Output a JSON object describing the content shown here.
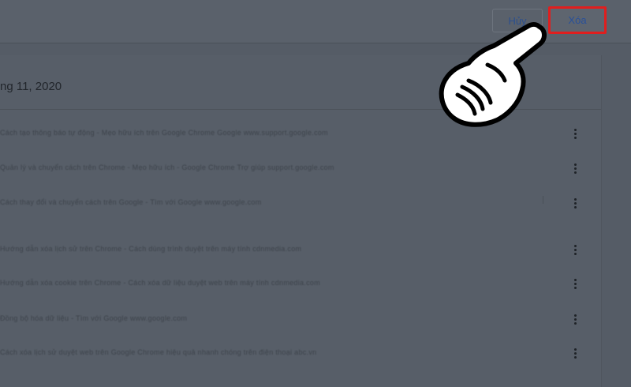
{
  "toolbar": {
    "cancel_label": "Hủy",
    "delete_label": "Xóa"
  },
  "section": {
    "date": "ng 11, 2020"
  },
  "rows": [
    {
      "text": "Cách tạo thông báo tự động - Mẹo hữu ích trên Google Chrome Google   www.support.google.com"
    },
    {
      "text": "Quản lý và chuyển cách trên Chrome - Mẹo hữu ích - Google Chrome Trợ giúp   support.google.com"
    },
    {
      "text": "Cách thay đổi và chuyển cách trên Google - Tìm với Google   www.google.com"
    },
    {
      "text": "Hướng dẫn xóa lịch sử trên Chrome - Cách dùng trình duyệt trên máy tính   cdnmedia.com"
    },
    {
      "text": "Hướng dẫn xóa cookie trên Chrome - Cách xóa dữ liệu duyệt web trên máy tính   cdnmedia.com"
    },
    {
      "text": "Đồng bộ hóa dữ liệu - Tìm với Google   www.google.com"
    },
    {
      "text": "Cách xóa lịch sử duyệt web trên Google Chrome hiệu quả nhanh chóng trên điện thoại   abc.vn"
    }
  ],
  "icons": {
    "row_menu": "more-vert-icon",
    "pointer": "pointing-hand-icon"
  },
  "colors": {
    "highlight": "#e01e1e",
    "link": "#28509a"
  }
}
